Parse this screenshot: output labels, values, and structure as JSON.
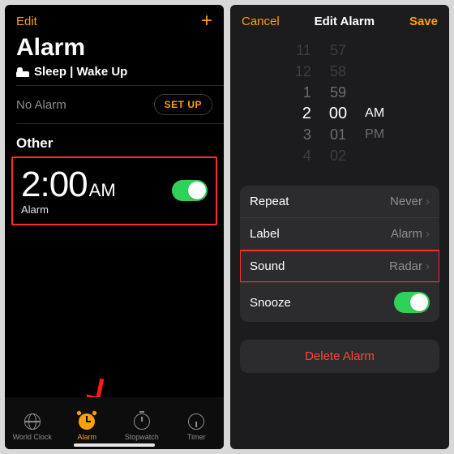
{
  "left": {
    "topbar": {
      "edit": "Edit",
      "add": "+"
    },
    "title": "Alarm",
    "sleep_section": {
      "label": "Sleep | Wake Up",
      "no_alarm": "No Alarm",
      "setup": "SET UP"
    },
    "other_label": "Other",
    "alarm": {
      "time": "2:00",
      "ampm": "AM",
      "label": "Alarm",
      "enabled": true
    },
    "tabs": {
      "world_clock": "World Clock",
      "alarm": "Alarm",
      "stopwatch": "Stopwatch",
      "timer": "Timer",
      "active": "alarm"
    }
  },
  "right": {
    "topbar": {
      "cancel": "Cancel",
      "title": "Edit Alarm",
      "save": "Save"
    },
    "picker": {
      "hours": [
        "11",
        "12",
        "1",
        "2",
        "3",
        "4"
      ],
      "minutes": [
        "57",
        "58",
        "59",
        "00",
        "01",
        "02"
      ],
      "ampm": [
        "AM",
        "PM"
      ],
      "selected": {
        "hour": "2",
        "minute": "00",
        "ampm": "AM"
      }
    },
    "rows": {
      "repeat": {
        "label": "Repeat",
        "value": "Never"
      },
      "label": {
        "label": "Label",
        "value": "Alarm"
      },
      "sound": {
        "label": "Sound",
        "value": "Radar"
      },
      "snooze": {
        "label": "Snooze",
        "enabled": true
      }
    },
    "delete": "Delete Alarm"
  },
  "colors": {
    "accent": "#ff9f0a",
    "toggle_on": "#30d158",
    "highlight": "#ff2d2d",
    "destructive": "#ff453a"
  }
}
